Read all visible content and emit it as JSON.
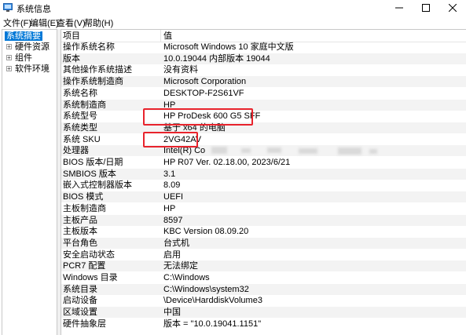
{
  "window": {
    "title": "系统信息"
  },
  "menu": [
    "文件(F)",
    "编辑(E)",
    "查看(V)",
    "帮助(H)"
  ],
  "tree": {
    "selected": "系统摘要",
    "children": [
      "硬件资源",
      "组件",
      "软件环境"
    ]
  },
  "list": {
    "headers": {
      "item": "项目",
      "value": "值"
    },
    "rows": [
      {
        "item": "操作系统名称",
        "value": "Microsoft Windows 10 家庭中文版"
      },
      {
        "item": "版本",
        "value": "10.0.19044 内部版本 19044"
      },
      {
        "item": "其他操作系统描述",
        "value": "没有资料"
      },
      {
        "item": "操作系统制造商",
        "value": "Microsoft Corporation"
      },
      {
        "item": "系统名称",
        "value": "DESKTOP-F2S61VF"
      },
      {
        "item": "系统制造商",
        "value": "HP"
      },
      {
        "item": "系统型号",
        "value": "HP ProDesk 600 G5 SFF"
      },
      {
        "item": "系统类型",
        "value": "基于 x64 的电脑"
      },
      {
        "item": "系统 SKU",
        "value": "2VG42AV"
      },
      {
        "item": "处理器",
        "value": "Intel(R) Co"
      },
      {
        "item": "BIOS 版本/日期",
        "value": "HP R07 Ver. 02.18.00, 2023/6/21"
      },
      {
        "item": "SMBIOS 版本",
        "value": "3.1"
      },
      {
        "item": "嵌入式控制器版本",
        "value": "8.09"
      },
      {
        "item": "BIOS 模式",
        "value": "UEFI"
      },
      {
        "item": "主板制造商",
        "value": "HP"
      },
      {
        "item": "主板产品",
        "value": "8597"
      },
      {
        "item": "主板版本",
        "value": "KBC Version 08.09.20"
      },
      {
        "item": "平台角色",
        "value": "台式机"
      },
      {
        "item": "安全启动状态",
        "value": "启用"
      },
      {
        "item": "PCR7 配置",
        "value": "无法绑定"
      },
      {
        "item": "Windows 目录",
        "value": "C:\\Windows"
      },
      {
        "item": "系统目录",
        "value": "C:\\Windows\\system32"
      },
      {
        "item": "启动设备",
        "value": "\\Device\\HarddiskVolume3"
      },
      {
        "item": "区域设置",
        "value": "中国"
      },
      {
        "item": "硬件抽象层",
        "value": "版本 = \"10.0.19041.1151\""
      }
    ],
    "highlighted_rows": [
      "系统型号",
      "系统 SKU"
    ]
  },
  "colors": {
    "selection": "#0078d7",
    "highlight_border": "#e8232c",
    "alt_row": "#f3f3f3"
  },
  "icons": [
    "system-info-icon",
    "minimize-icon",
    "maximize-icon",
    "close-icon",
    "tree-expander-icon"
  ]
}
